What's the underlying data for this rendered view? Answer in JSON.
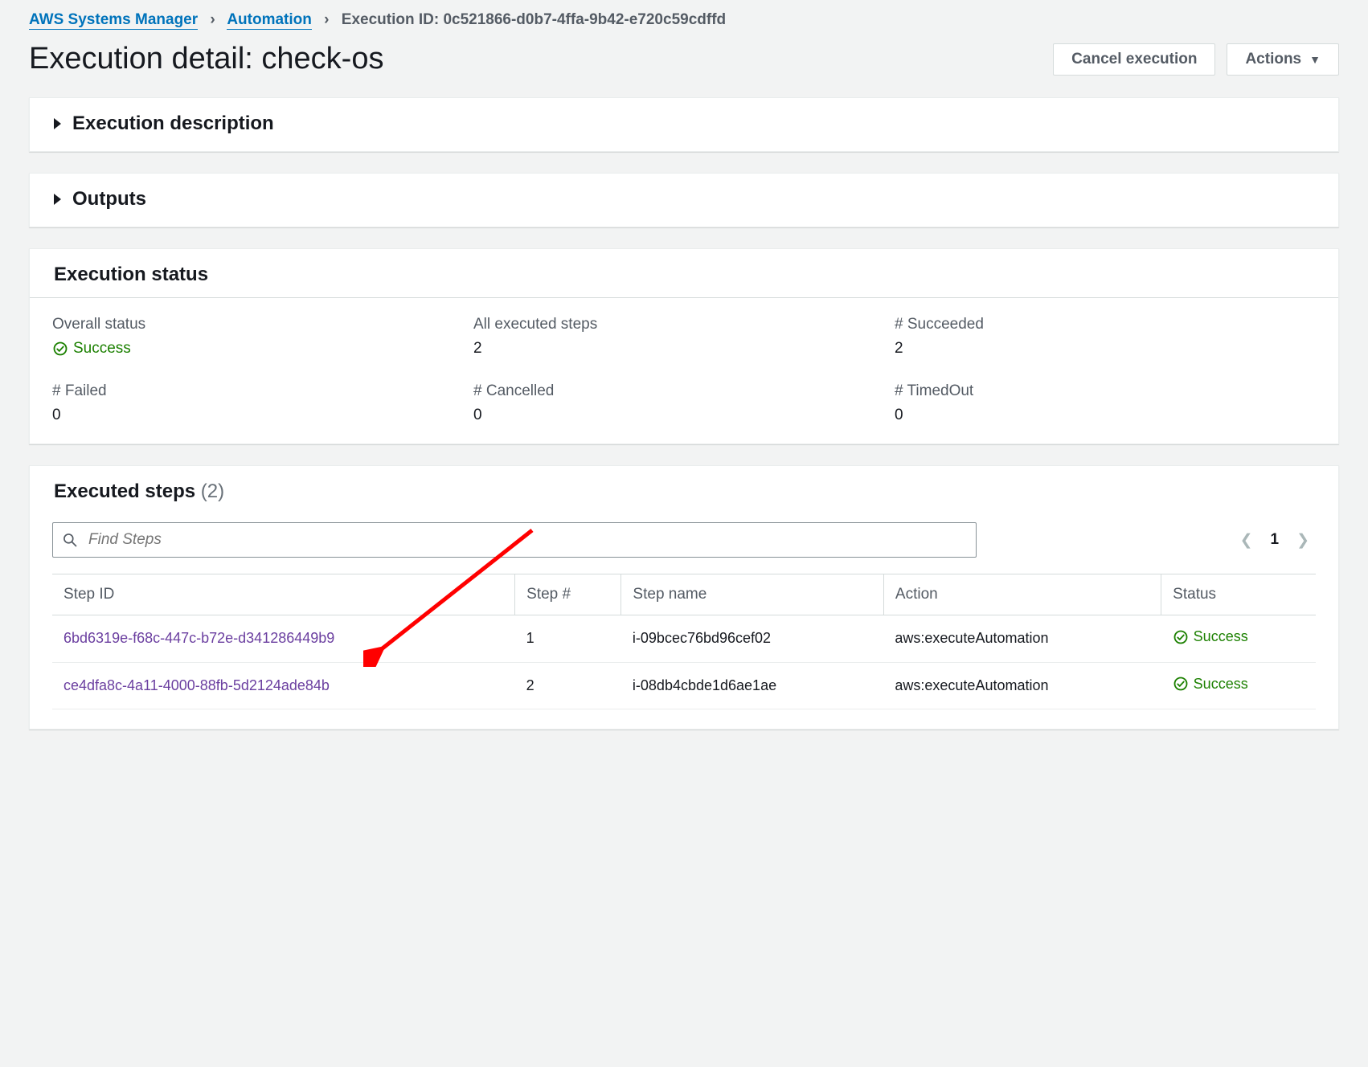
{
  "breadcrumb": {
    "l1": "AWS Systems Manager",
    "l2": "Automation",
    "l3": "Execution ID: 0c521866-d0b7-4ffa-9b42-e720c59cdffd"
  },
  "title": "Execution detail: check-os",
  "buttons": {
    "cancel": "Cancel execution",
    "actions": "Actions"
  },
  "panels": {
    "desc_title": "Execution description",
    "outputs_title": "Outputs",
    "status_title": "Execution status",
    "steps_title": "Executed steps",
    "steps_count": "(2)"
  },
  "status": {
    "overall_label": "Overall status",
    "overall_value": "Success",
    "all_label": "All executed steps",
    "all_value": "2",
    "succ_label": "# Succeeded",
    "succ_value": "2",
    "failed_label": "# Failed",
    "failed_value": "0",
    "cancelled_label": "# Cancelled",
    "cancelled_value": "0",
    "timedout_label": "# TimedOut",
    "timedout_value": "0"
  },
  "search": {
    "placeholder": "Find Steps"
  },
  "pager": {
    "page": "1"
  },
  "table": {
    "head": {
      "id": "Step ID",
      "num": "Step #",
      "name": "Step name",
      "action": "Action",
      "status": "Status"
    },
    "rows": [
      {
        "id": "6bd6319e-f68c-447c-b72e-d341286449b9",
        "num": "1",
        "name": "i-09bcec76bd96cef02",
        "action": "aws:executeAutomation",
        "status": "Success"
      },
      {
        "id": "ce4dfa8c-4a11-4000-88fb-5d2124ade84b",
        "num": "2",
        "name": "i-08db4cbde1d6ae1ae",
        "action": "aws:executeAutomation",
        "status": "Success"
      }
    ]
  }
}
